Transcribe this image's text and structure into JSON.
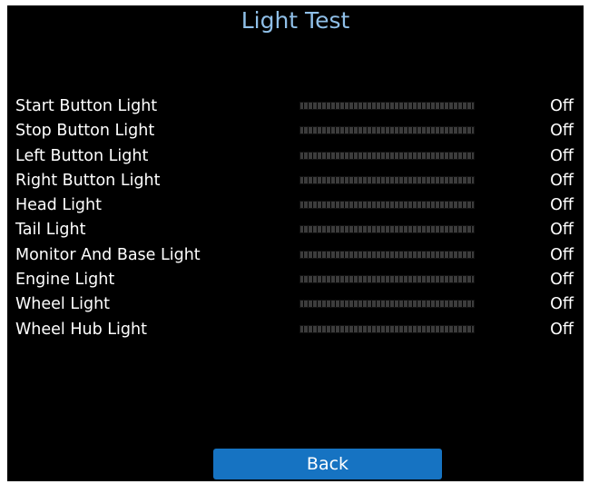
{
  "title": "Light Test",
  "lights": [
    {
      "label": "Start Button Light",
      "status": "Off",
      "level": 0
    },
    {
      "label": "Stop Button Light",
      "status": "Off",
      "level": 0
    },
    {
      "label": "Left Button Light",
      "status": "Off",
      "level": 0
    },
    {
      "label": "Right Button Light",
      "status": "Off",
      "level": 0
    },
    {
      "label": "Head Light",
      "status": "Off",
      "level": 0
    },
    {
      "label": "Tail Light",
      "status": "Off",
      "level": 0
    },
    {
      "label": "Monitor And Base Light",
      "status": "Off",
      "level": 0
    },
    {
      "label": "Engine Light",
      "status": "Off",
      "level": 0
    },
    {
      "label": "Wheel Light",
      "status": "Off",
      "level": 0
    },
    {
      "label": "Wheel Hub Light",
      "status": "Off",
      "level": 0
    }
  ],
  "back_button": {
    "label": "Back"
  },
  "colors": {
    "background": "#000000",
    "title": "#8fbfe8",
    "text": "#ffffff",
    "bar_segment": "#3c3c3c",
    "button": "#1673c2"
  }
}
